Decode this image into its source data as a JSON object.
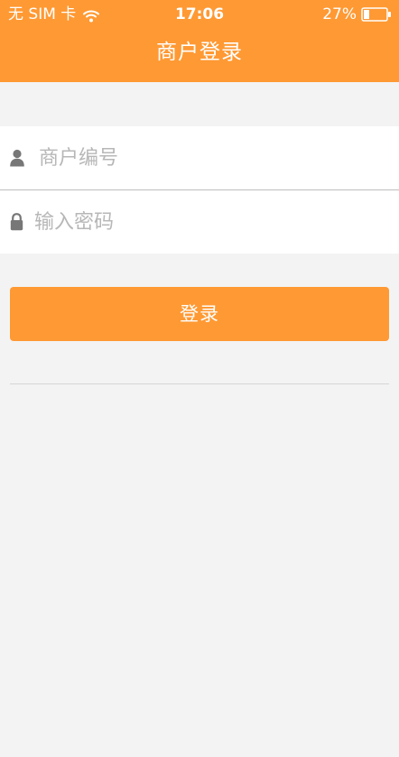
{
  "status_bar": {
    "carrier": "无 SIM 卡",
    "time": "17:06",
    "battery": "27%",
    "battery_level": 0.27
  },
  "header": {
    "title": "商户登录"
  },
  "form": {
    "merchant_placeholder": "商户编号",
    "merchant_value": "",
    "password_placeholder": "输入密码",
    "password_value": ""
  },
  "actions": {
    "login_label": "登录"
  },
  "colors": {
    "accent": "#ff9933",
    "background": "#f3f3f3",
    "field_background": "#ffffff",
    "placeholder": "#b7b7b7"
  },
  "icons": {
    "wifi": "wifi-icon",
    "battery": "battery-icon",
    "user": "user-icon",
    "lock": "lock-icon"
  }
}
